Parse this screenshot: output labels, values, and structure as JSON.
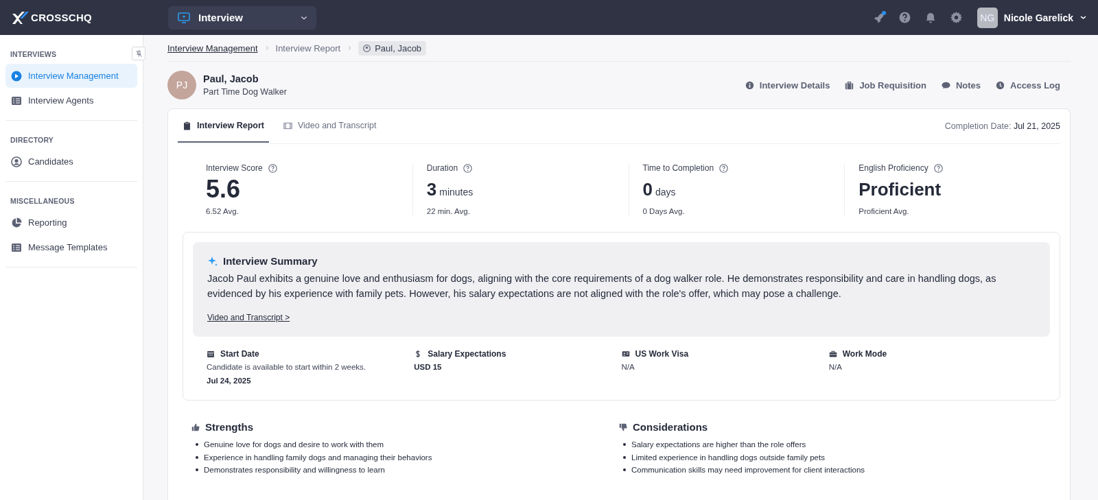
{
  "header": {
    "logo": "CROSSCHQ",
    "product": "Interview",
    "has_notification": true,
    "user": {
      "initials": "NG",
      "name": "Nicole Garelick"
    }
  },
  "sidebar": {
    "sections": [
      {
        "heading": "INTERVIEWS",
        "items": [
          {
            "label": "Interview Management",
            "selected": true
          },
          {
            "label": "Interview Agents",
            "selected": false
          }
        ]
      },
      {
        "heading": "DIRECTORY",
        "items": [
          {
            "label": "Candidates",
            "selected": false
          }
        ]
      },
      {
        "heading": "MISCELLANEOUS",
        "items": [
          {
            "label": "Reporting",
            "selected": false
          },
          {
            "label": "Message Templates",
            "selected": false
          }
        ]
      }
    ]
  },
  "breadcrumb": [
    {
      "label": "Interview Management",
      "kind": "link"
    },
    {
      "label": "Interview Report",
      "kind": "text"
    },
    {
      "label": "Paul, Jacob",
      "kind": "current"
    }
  ],
  "candidate": {
    "initials": "PJ",
    "name": "Paul, Jacob",
    "role": "Part Time Dog Walker"
  },
  "actions": [
    "Interview Details",
    "Job Requisition",
    "Notes",
    "Access Log"
  ],
  "tabs": [
    {
      "label": "Interview Report",
      "selected": true
    },
    {
      "label": "Video and Transcript",
      "selected": false
    }
  ],
  "completion": {
    "label": "Completion Date:",
    "value": "Jul 21, 2025"
  },
  "metrics": [
    {
      "label": "Interview Score",
      "value": "5.6",
      "average": "6.52 Avg."
    },
    {
      "label": "Duration",
      "value": "3",
      "unit": "minutes",
      "average": "22 min. Avg."
    },
    {
      "label": "Time to Completion",
      "value": "0",
      "unit": "days",
      "average": "0 Days Avg."
    },
    {
      "label": "English Proficiency",
      "value": "Proficient",
      "average": "Proficient Avg."
    }
  ],
  "summary": {
    "title": "Interview Summary",
    "text": "Jacob Paul exhibits a genuine love and enthusiasm for dogs, aligning with the core requirements of a dog walker role. He demonstrates responsibility and care in handling dogs, as evidenced by his experience with family pets. However, his salary expectations are not aligned with the role's offer, which may pose a challenge.",
    "link": "Video and Transcript >"
  },
  "details": [
    {
      "label": "Start Date",
      "description": "Candidate is available to start within 2 weeks.",
      "value": "Jul 24, 2025",
      "emphasis": true
    },
    {
      "label": "Salary Expectations",
      "value": "USD 15",
      "emphasis": true
    },
    {
      "label": "US Work Visa",
      "value": "N/A",
      "emphasis": false
    },
    {
      "label": "Work Mode",
      "value": "N/A",
      "emphasis": false
    }
  ],
  "strengths": {
    "title": "Strengths",
    "items": [
      "Genuine love for dogs and desire to work with them",
      "Experience in handling family dogs and managing their behaviors",
      "Demonstrates responsibility and willingness to learn"
    ]
  },
  "considerations": {
    "title": "Considerations",
    "items": [
      "Salary expectations are higher than the role offers",
      "Limited experience in handling dogs outside family pets",
      "Communication skills may need improvement for client interactions"
    ]
  }
}
